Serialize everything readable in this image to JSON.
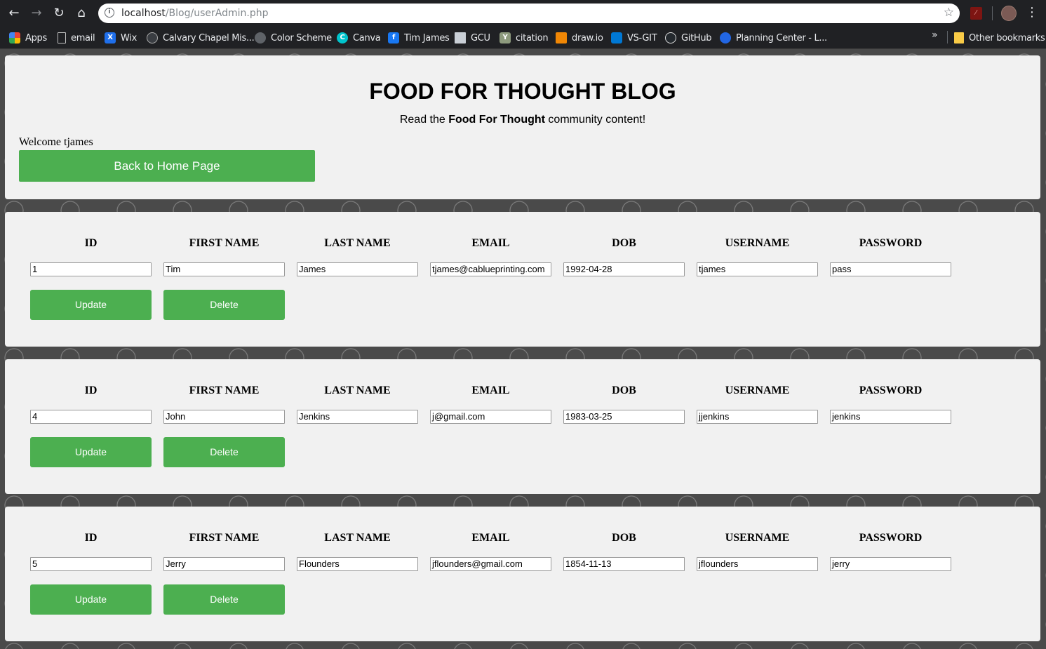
{
  "browser": {
    "url_host": "localhost",
    "url_path": "/Blog/userAdmin.php",
    "bookmarks": [
      {
        "label": "Apps",
        "icon": "apps-grid-icon",
        "color": "#e8453c"
      },
      {
        "label": "email",
        "icon": "page-icon",
        "color": "#202124"
      },
      {
        "label": "Wix",
        "icon": "wix-icon",
        "color": "#1f6feb"
      },
      {
        "label": "Calvary Chapel Mis...",
        "icon": "globe-icon",
        "color": "#5f6368"
      },
      {
        "label": "Color Scheme",
        "icon": "color-scheme-icon",
        "color": "#5f6368"
      },
      {
        "label": "Canva",
        "icon": "canva-icon",
        "color": "#00c4cc"
      },
      {
        "label": "Tim James",
        "icon": "facebook-icon",
        "color": "#1877f2"
      },
      {
        "label": "GCU",
        "icon": "gcu-icon",
        "color": "#c9cfd6"
      },
      {
        "label": "citation",
        "icon": "citation-icon",
        "color": "#8d9a7d"
      },
      {
        "label": "draw.io",
        "icon": "drawio-icon",
        "color": "#f08705"
      },
      {
        "label": "VS-GIT",
        "icon": "azure-devops-icon",
        "color": "#0078d4"
      },
      {
        "label": "GitHub",
        "icon": "github-icon",
        "color": "#24292e"
      },
      {
        "label": "Planning Center - L...",
        "icon": "planning-center-icon",
        "color": "#2266e3"
      }
    ],
    "more_label": "»",
    "other_bookmarks": "Other bookmarks"
  },
  "header": {
    "title": "FOOD FOR THOUGHT BLOG",
    "tagline_prefix": "Read the ",
    "tagline_bold": "Food For Thought",
    "tagline_suffix": " community content!",
    "welcome": "Welcome tjames",
    "home_button": "Back to Home Page"
  },
  "columns": [
    "ID",
    "FIRST NAME",
    "LAST NAME",
    "EMAIL",
    "DOB",
    "USERNAME",
    "PASSWORD"
  ],
  "users": [
    {
      "id": "1",
      "first": "Tim",
      "last": "James",
      "email": "tjames@cablueprinting.com",
      "dob": "1992-04-28",
      "username": "tjames",
      "password": "pass"
    },
    {
      "id": "4",
      "first": "John",
      "last": "Jenkins",
      "email": "j@gmail.com",
      "dob": "1983-03-25",
      "username": "jjenkins",
      "password": "jenkins"
    },
    {
      "id": "5",
      "first": "Jerry",
      "last": "Flounders",
      "email": "jflounders@gmail.com",
      "dob": "1854-11-13",
      "username": "jflounders",
      "password": "jerry"
    }
  ],
  "actions": {
    "update": "Update",
    "delete": "Delete"
  },
  "colors": {
    "accent_green": "#4caf50",
    "panel": "#f1f1f1",
    "page_bg": "#4a4a4a"
  }
}
